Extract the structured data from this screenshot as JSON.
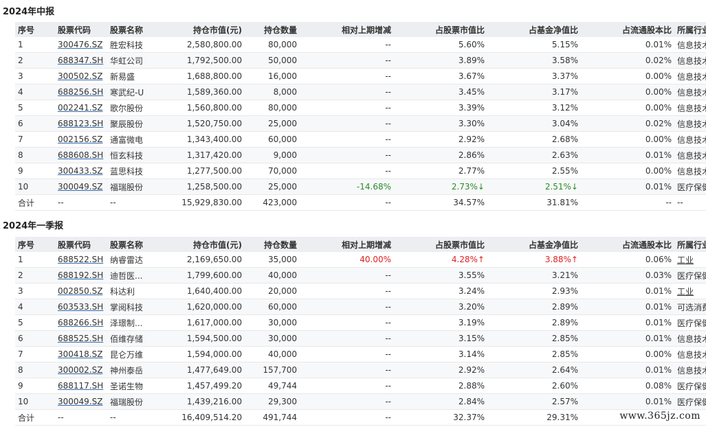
{
  "columns": [
    "序号",
    "股票代码",
    "股票名称",
    "持仓市值(元)",
    "持仓数量",
    "相对上期增减",
    "占股票市值比",
    "占基金净值比",
    "占流通股本比",
    "所属行业"
  ],
  "sections": [
    {
      "title": "2024年中报",
      "rows": [
        {
          "no": "1",
          "code": "300476.SZ",
          "name": "胜宏科技",
          "value": "2,580,800.00",
          "qty": "80,000",
          "change": "--",
          "stock_ratio": "5.60%",
          "nav_ratio": "5.15%",
          "float_ratio": "0.01%",
          "industry": "信息技术"
        },
        {
          "no": "2",
          "code": "688347.SH",
          "name": "华虹公司",
          "value": "1,792,500.00",
          "qty": "50,000",
          "change": "--",
          "stock_ratio": "3.89%",
          "nav_ratio": "3.58%",
          "float_ratio": "0.02%",
          "industry": "信息技术"
        },
        {
          "no": "3",
          "code": "300502.SZ",
          "name": "新易盛",
          "value": "1,688,800.00",
          "qty": "16,000",
          "change": "--",
          "stock_ratio": "3.67%",
          "nav_ratio": "3.37%",
          "float_ratio": "0.00%",
          "industry": "信息技术"
        },
        {
          "no": "4",
          "code": "688256.SH",
          "name": "寒武纪-U",
          "value": "1,589,360.00",
          "qty": "8,000",
          "change": "--",
          "stock_ratio": "3.45%",
          "nav_ratio": "3.17%",
          "float_ratio": "0.00%",
          "industry": "信息技术"
        },
        {
          "no": "5",
          "code": "002241.SZ",
          "name": "歌尔股份",
          "value": "1,560,800.00",
          "qty": "80,000",
          "change": "--",
          "stock_ratio": "3.39%",
          "nav_ratio": "3.12%",
          "float_ratio": "0.00%",
          "industry": "信息技术"
        },
        {
          "no": "6",
          "code": "688123.SH",
          "name": "聚辰股份",
          "value": "1,520,750.00",
          "qty": "25,000",
          "change": "--",
          "stock_ratio": "3.30%",
          "nav_ratio": "3.04%",
          "float_ratio": "0.02%",
          "industry": "信息技术"
        },
        {
          "no": "7",
          "code": "002156.SZ",
          "name": "通富微电",
          "value": "1,343,400.00",
          "qty": "60,000",
          "change": "--",
          "stock_ratio": "2.92%",
          "nav_ratio": "2.68%",
          "float_ratio": "0.00%",
          "industry": "信息技术"
        },
        {
          "no": "8",
          "code": "688608.SH",
          "name": "恒玄科技",
          "value": "1,317,420.00",
          "qty": "9,000",
          "change": "--",
          "stock_ratio": "2.86%",
          "nav_ratio": "2.63%",
          "float_ratio": "0.01%",
          "industry": "信息技术"
        },
        {
          "no": "9",
          "code": "300433.SZ",
          "name": "蓝思科技",
          "value": "1,277,500.00",
          "qty": "70,000",
          "change": "--",
          "stock_ratio": "2.77%",
          "nav_ratio": "2.55%",
          "float_ratio": "0.00%",
          "industry": "信息技术"
        },
        {
          "no": "10",
          "code": "300049.SZ",
          "name": "福瑞股份",
          "value": "1,258,500.00",
          "qty": "25,000",
          "change": "-14.68%",
          "change_color": "green",
          "stock_ratio": "2.73%↓",
          "stock_ratio_color": "green",
          "nav_ratio": "2.51%↓",
          "nav_ratio_color": "green",
          "float_ratio": "0.01%",
          "industry": "医疗保健"
        }
      ],
      "total": {
        "no": "合计",
        "code": "--",
        "name": "--",
        "value": "15,929,830.00",
        "qty": "423,000",
        "change": "--",
        "stock_ratio": "34.57%",
        "nav_ratio": "31.81%",
        "float_ratio": "--",
        "industry": "--"
      }
    },
    {
      "title": "2024年一季报",
      "rows": [
        {
          "no": "1",
          "code": "688522.SH",
          "name": "纳睿雷达",
          "value": "2,169,650.00",
          "qty": "35,000",
          "change": "40.00%",
          "change_color": "red",
          "stock_ratio": "4.28%↑",
          "stock_ratio_color": "red",
          "nav_ratio": "3.88%↑",
          "nav_ratio_color": "red",
          "float_ratio": "0.06%",
          "industry": "工业",
          "industry_link": true
        },
        {
          "no": "2",
          "code": "688192.SH",
          "name": "迪哲医...",
          "value": "1,799,600.00",
          "qty": "40,000",
          "change": "--",
          "stock_ratio": "3.55%",
          "nav_ratio": "3.21%",
          "float_ratio": "0.03%",
          "industry": "医疗保健"
        },
        {
          "no": "3",
          "code": "002850.SZ",
          "name": "科达利",
          "value": "1,640,400.00",
          "qty": "20,000",
          "change": "--",
          "stock_ratio": "3.24%",
          "nav_ratio": "2.93%",
          "float_ratio": "0.01%",
          "industry": "工业",
          "industry_link": true
        },
        {
          "no": "4",
          "code": "603533.SH",
          "name": "掌阅科技",
          "value": "1,620,000.00",
          "qty": "60,000",
          "change": "--",
          "stock_ratio": "3.20%",
          "nav_ratio": "2.89%",
          "float_ratio": "0.01%",
          "industry": "可选消费"
        },
        {
          "no": "5",
          "code": "688266.SH",
          "name": "泽璟制...",
          "value": "1,617,000.00",
          "qty": "30,000",
          "change": "--",
          "stock_ratio": "3.19%",
          "nav_ratio": "2.89%",
          "float_ratio": "0.01%",
          "industry": "医疗保健"
        },
        {
          "no": "6",
          "code": "688525.SH",
          "name": "佰维存储",
          "value": "1,594,500.00",
          "qty": "30,000",
          "change": "--",
          "stock_ratio": "3.15%",
          "nav_ratio": "2.85%",
          "float_ratio": "0.01%",
          "industry": "信息技术"
        },
        {
          "no": "7",
          "code": "300418.SZ",
          "name": "昆仑万维",
          "value": "1,594,000.00",
          "qty": "40,000",
          "change": "--",
          "stock_ratio": "3.14%",
          "nav_ratio": "2.85%",
          "float_ratio": "0.00%",
          "industry": "信息技术"
        },
        {
          "no": "8",
          "code": "300002.SZ",
          "name": "神州泰岳",
          "value": "1,477,649.00",
          "qty": "157,700",
          "change": "--",
          "stock_ratio": "2.92%",
          "nav_ratio": "2.64%",
          "float_ratio": "0.01%",
          "industry": "信息技术"
        },
        {
          "no": "9",
          "code": "688117.SH",
          "name": "圣诺生物",
          "value": "1,457,499.20",
          "qty": "49,744",
          "change": "--",
          "stock_ratio": "2.88%",
          "nav_ratio": "2.60%",
          "float_ratio": "0.08%",
          "industry": "医疗保健"
        },
        {
          "no": "10",
          "code": "300049.SZ",
          "name": "福瑞股份",
          "value": "1,439,216.00",
          "qty": "29,300",
          "change": "--",
          "stock_ratio": "2.84%",
          "nav_ratio": "2.57%",
          "float_ratio": "0.01%",
          "industry": "医疗保健"
        }
      ],
      "total": {
        "no": "合计",
        "code": "--",
        "name": "--",
        "value": "16,409,514.20",
        "qty": "491,744",
        "change": "--",
        "stock_ratio": "32.37%",
        "nav_ratio": "29.31%",
        "float_ratio": "",
        "industry": ""
      }
    }
  ],
  "watermark": "www.365jz.com",
  "colors": {
    "header_bg": "#eceef1",
    "alt_row_bg": "#f7f8fa",
    "up": "#e02020",
    "down": "#2a8a2a",
    "link_underline": "#2d6bb5"
  }
}
